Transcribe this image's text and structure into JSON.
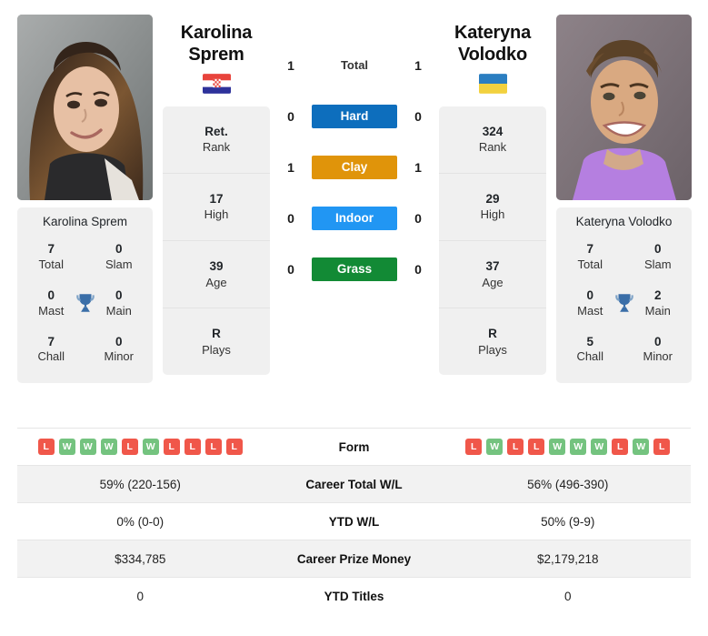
{
  "colors": {
    "hard": "#0d6ebd",
    "clay": "#e0940a",
    "indoor": "#2196f3",
    "grass": "#128a35",
    "win": "#74c37f",
    "loss": "#f0574a",
    "trophy": "#3a6ea8",
    "panel": "#f0f0f0"
  },
  "players": {
    "left": {
      "name_line1": "Karolina",
      "name_line2": "Sprem",
      "full_name": "Karolina Sprem",
      "flag": "croatia-flag",
      "rank_stats": [
        {
          "value": "Ret.",
          "label": "Rank"
        },
        {
          "value": "17",
          "label": "High"
        },
        {
          "value": "39",
          "label": "Age"
        },
        {
          "value": "R",
          "label": "Plays"
        }
      ],
      "titles": [
        {
          "value": "7",
          "label": "Total"
        },
        {
          "value": "0",
          "label": "Slam"
        },
        {
          "value": "0",
          "label": "Mast"
        },
        {
          "value": "0",
          "label": "Main"
        },
        {
          "value": "7",
          "label": "Chall"
        },
        {
          "value": "0",
          "label": "Minor"
        }
      ],
      "form": [
        "L",
        "W",
        "W",
        "W",
        "L",
        "W",
        "L",
        "L",
        "L",
        "L"
      ]
    },
    "right": {
      "name_line1": "Kateryna",
      "name_line2": "Volodko",
      "full_name": "Kateryna Volodko",
      "flag": "ukraine-flag",
      "rank_stats": [
        {
          "value": "324",
          "label": "Rank"
        },
        {
          "value": "29",
          "label": "High"
        },
        {
          "value": "37",
          "label": "Age"
        },
        {
          "value": "R",
          "label": "Plays"
        }
      ],
      "titles": [
        {
          "value": "7",
          "label": "Total"
        },
        {
          "value": "0",
          "label": "Slam"
        },
        {
          "value": "0",
          "label": "Mast"
        },
        {
          "value": "2",
          "label": "Main"
        },
        {
          "value": "5",
          "label": "Chall"
        },
        {
          "value": "0",
          "label": "Minor"
        }
      ],
      "form": [
        "L",
        "W",
        "L",
        "L",
        "W",
        "W",
        "W",
        "L",
        "W",
        "L"
      ]
    }
  },
  "surfaces": [
    {
      "label": "Total",
      "left": "1",
      "right": "1",
      "style": "plain"
    },
    {
      "label": "Hard",
      "left": "0",
      "right": "0",
      "style": "hard"
    },
    {
      "label": "Clay",
      "left": "1",
      "right": "1",
      "style": "clay"
    },
    {
      "label": "Indoor",
      "left": "0",
      "right": "0",
      "style": "indoor"
    },
    {
      "label": "Grass",
      "left": "0",
      "right": "0",
      "style": "grass"
    }
  ],
  "stats_table": [
    {
      "label": "Form",
      "left": "",
      "right": "",
      "type": "form",
      "alt": false
    },
    {
      "label": "Career Total W/L",
      "left": "59% (220-156)",
      "right": "56% (496-390)",
      "type": "text",
      "alt": true
    },
    {
      "label": "YTD W/L",
      "left": "0% (0-0)",
      "right": "50% (9-9)",
      "type": "text",
      "alt": false
    },
    {
      "label": "Career Prize Money",
      "left": "$334,785",
      "right": "$2,179,218",
      "type": "text",
      "alt": true
    },
    {
      "label": "YTD Titles",
      "left": "0",
      "right": "0",
      "type": "text",
      "alt": false
    }
  ]
}
